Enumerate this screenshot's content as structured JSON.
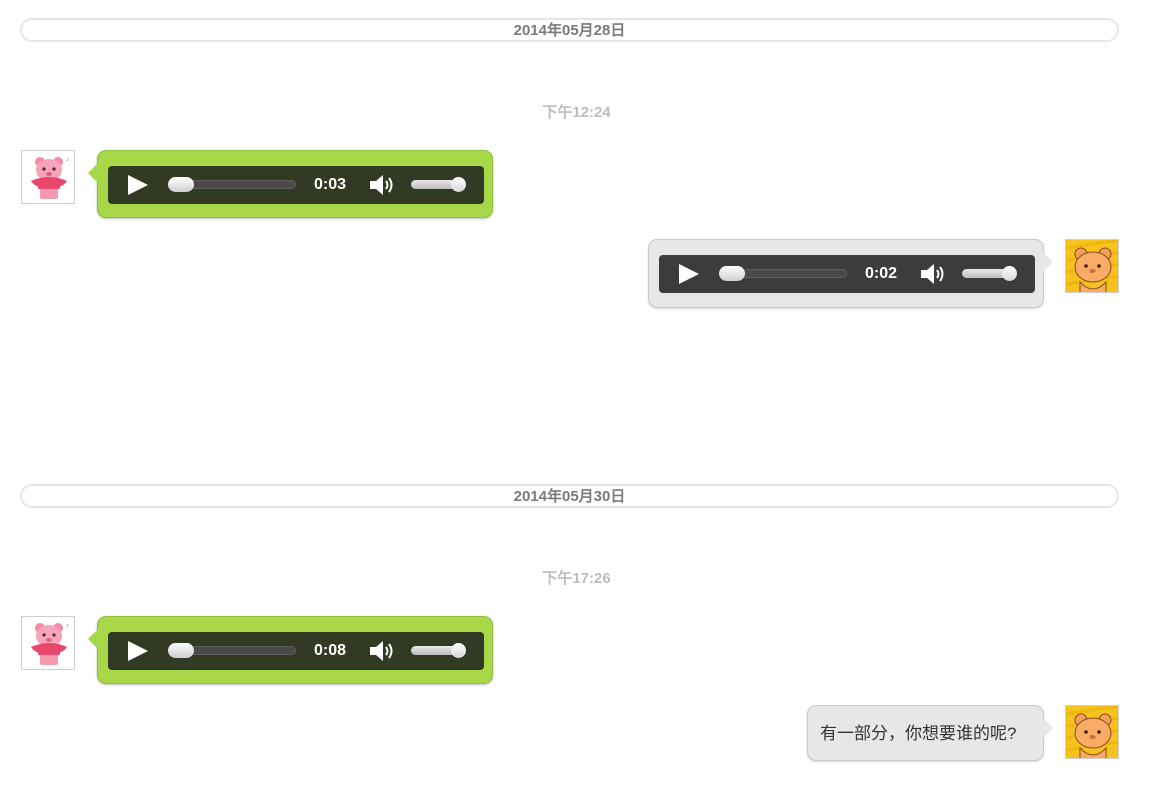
{
  "groups": [
    {
      "date": "2014年05月28日",
      "time": "下午12:24",
      "messages": [
        {
          "side": "left",
          "type": "voice",
          "duration": "0:03",
          "progress": 0.0,
          "volume": 1.0
        },
        {
          "side": "right",
          "type": "voice",
          "duration": "0:02",
          "progress": 0.0,
          "volume": 1.0
        }
      ]
    },
    {
      "date": "2014年05月30日",
      "time": "下午17:26",
      "messages": [
        {
          "side": "left",
          "type": "voice",
          "duration": "0:08",
          "progress": 0.0,
          "volume": 1.0
        },
        {
          "side": "right",
          "type": "text",
          "text": "有一部分，你想要谁的呢?"
        }
      ]
    }
  ],
  "avatars": {
    "left": "pink-bear-flowerpot-avatar",
    "right": "orange-bear-avatar"
  },
  "colors": {
    "incoming_bubble": "#a8d84a",
    "outgoing_bubble": "#e7e7e7",
    "player_incoming": "#333a24",
    "player_outgoing": "#3c3c3c"
  },
  "icons": {
    "play": "play-icon",
    "volume": "volume-icon"
  }
}
